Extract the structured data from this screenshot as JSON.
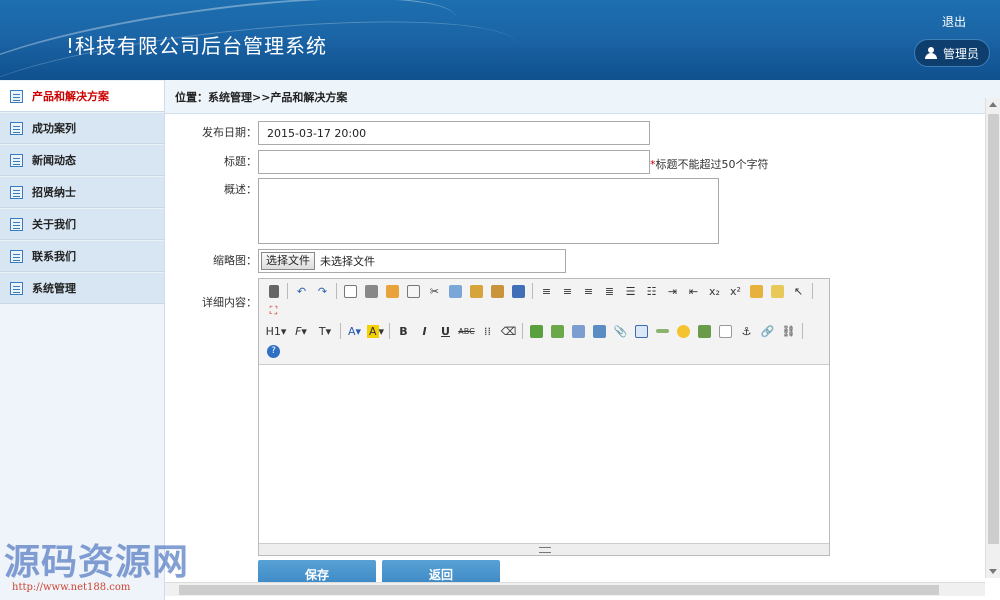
{
  "header": {
    "title": "!科技有限公司后台管理系统",
    "logout": "退出",
    "admin": "管理员"
  },
  "sidebar": {
    "items": [
      {
        "label": "产品和解决方案",
        "active": true
      },
      {
        "label": "成功案列"
      },
      {
        "label": "新闻动态"
      },
      {
        "label": "招贤纳士"
      },
      {
        "label": "关于我们"
      },
      {
        "label": "联系我们"
      },
      {
        "label": "系统管理"
      }
    ]
  },
  "breadcrumb": "位置：系统管理>>产品和解决方案",
  "form": {
    "date_label": "发布日期：",
    "date_value": "2015-03-17 20:00",
    "title_label": "标题：",
    "title_value": "",
    "title_hint_star": "*",
    "title_hint": "标题不能超过50个字符",
    "summary_label": "概述：",
    "summary_value": "",
    "thumb_label": "缩略图：",
    "file_button": "选择文件",
    "file_status": "未选择文件",
    "content_label": "详细内容：",
    "save_button": "保存",
    "back_button": "返回"
  },
  "toolbar": {
    "heading": "H1",
    "font_family": "F",
    "font_size": "T"
  },
  "watermark": {
    "text": "源码资源网",
    "url": "http://www.net188.com"
  }
}
